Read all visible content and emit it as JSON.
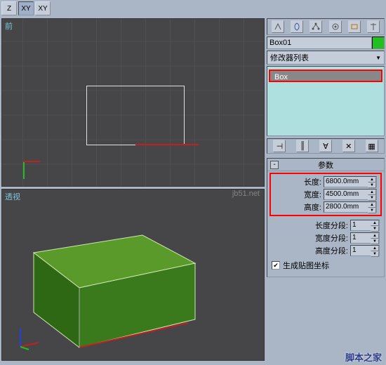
{
  "toolbar": {
    "constraints": [
      "Z",
      "XY",
      "XY"
    ]
  },
  "viewports": {
    "front_label": "前",
    "persp_label": "透视"
  },
  "command_panel": {
    "icons": [
      "pointer",
      "configure",
      "hierarchy",
      "motion",
      "display",
      "util"
    ]
  },
  "object": {
    "name": "Box01",
    "color": "#20c020"
  },
  "modifier_dropdown": "修改器列表",
  "stack": {
    "item": "Box"
  },
  "rollout": {
    "title": "参数",
    "length_label": "长度:",
    "width_label": "宽度:",
    "height_label": "高度:",
    "length_val": "6800.0mm",
    "width_val": "4500.0mm",
    "height_val": "2800.0mm",
    "lseg_label": "长度分段:",
    "wseg_label": "宽度分段:",
    "hseg_label": "高度分段:",
    "lseg_val": "1",
    "wseg_val": "1",
    "hseg_val": "1",
    "genmap_label": "生成贴图坐标",
    "genmap_checked": "✔"
  },
  "watermark": "jb51.net",
  "footer": "脚本之家"
}
